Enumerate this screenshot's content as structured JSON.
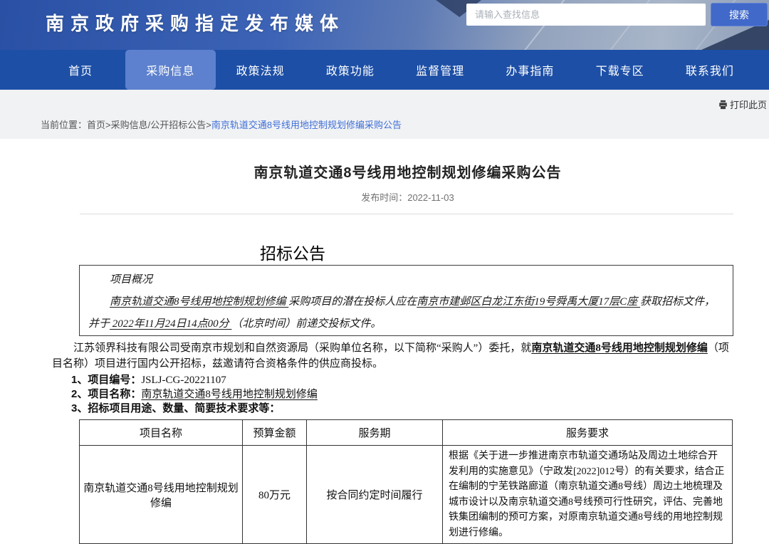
{
  "header": {
    "site_title": "南京政府采购指定发布媒体",
    "search_placeholder": "请输入查找信息",
    "search_button_label": "搜索"
  },
  "nav": {
    "items": [
      {
        "label": "首页",
        "active": false
      },
      {
        "label": "采购信息",
        "active": true
      },
      {
        "label": "政策法规",
        "active": false
      },
      {
        "label": "政策功能",
        "active": false
      },
      {
        "label": "监督管理",
        "active": false
      },
      {
        "label": "办事指南",
        "active": false
      },
      {
        "label": "下载专区",
        "active": false
      },
      {
        "label": "联系我们",
        "active": false
      }
    ]
  },
  "toolbar": {
    "print_label": "打印此页"
  },
  "breadcrumb": {
    "prefix": "当前位置：",
    "path": "首页>采购信息/公开招标公告>",
    "current": "南京轨道交通8号线用地控制规划修编采购公告"
  },
  "article": {
    "title": "南京轨道交通8号线用地控制规划修编采购公告",
    "publish_time": "发布时间：2022-11-03",
    "section_heading": "招标公告",
    "overview": {
      "heading": "项目概况",
      "segment_project_name": "南京轨道交通8号线用地控制规划修编 ",
      "segment_text_1": "采购项目的潜在投标人应在",
      "segment_address": "南京市建邺区白龙江东街19号舜禹大厦17层C座 ",
      "segment_text_2": "获取招标文件，并于",
      "segment_deadline": " 2022年11月24日14点00分 ",
      "segment_text_3": "（北京时间）前递交投标文件。"
    },
    "intro": {
      "part_1": "江苏领界科技有限公司受南京市规划和自然资源局（采购单位名称，以下简称“采购人”）委托，就",
      "project_name": "南京轨道交通8号线用地控制规划修编",
      "part_2": "（项目名称）项目进行国内公开招标，兹邀请符合资格条件的供应商投标。"
    },
    "items": [
      {
        "label": "1、项目编号：",
        "value": "JSLJ-CG-20221107"
      },
      {
        "label": "2、项目名称：",
        "value": "南京轨道交通8号线用地控制规划修编"
      },
      {
        "label": "3、招标项目用途、数量、简要技术要求等：",
        "value": ""
      }
    ]
  },
  "table": {
    "headers": [
      "项目名称",
      "预算金额",
      "服务期",
      "服务要求"
    ],
    "rows": [
      {
        "project_name": "南京轨道交通8号线用地控制规划修编",
        "budget": "80万元",
        "service_period": "按合同约定时间履行",
        "service_requirements": "根据《关于进一步推进南京市轨道交通场站及周边土地综合开发利用的实施意见》（宁政发[2022]012号）的有关要求，结合正在编制的宁芜铁路廊道（南京轨道交通8号线）周边土地梳理及城市设计以及南京轨道交通8号线预可行性研究，评估、完善地铁集团编制的预可方案，对原南京轨道交通8号线的用地控制规划进行修编。"
      }
    ]
  },
  "colors": {
    "nav_background": "#1d4fa6",
    "nav_active_background": "#5d81ce",
    "header_gradient_start": "#2950a4",
    "header_gradient_end": "#8d9db8",
    "search_button_background": "#4169c9",
    "breadcrumb_link": "#3f6fd8",
    "strip_background": "#f1f2f4",
    "panel_background": "#ffffff",
    "border_color": "#333333"
  }
}
